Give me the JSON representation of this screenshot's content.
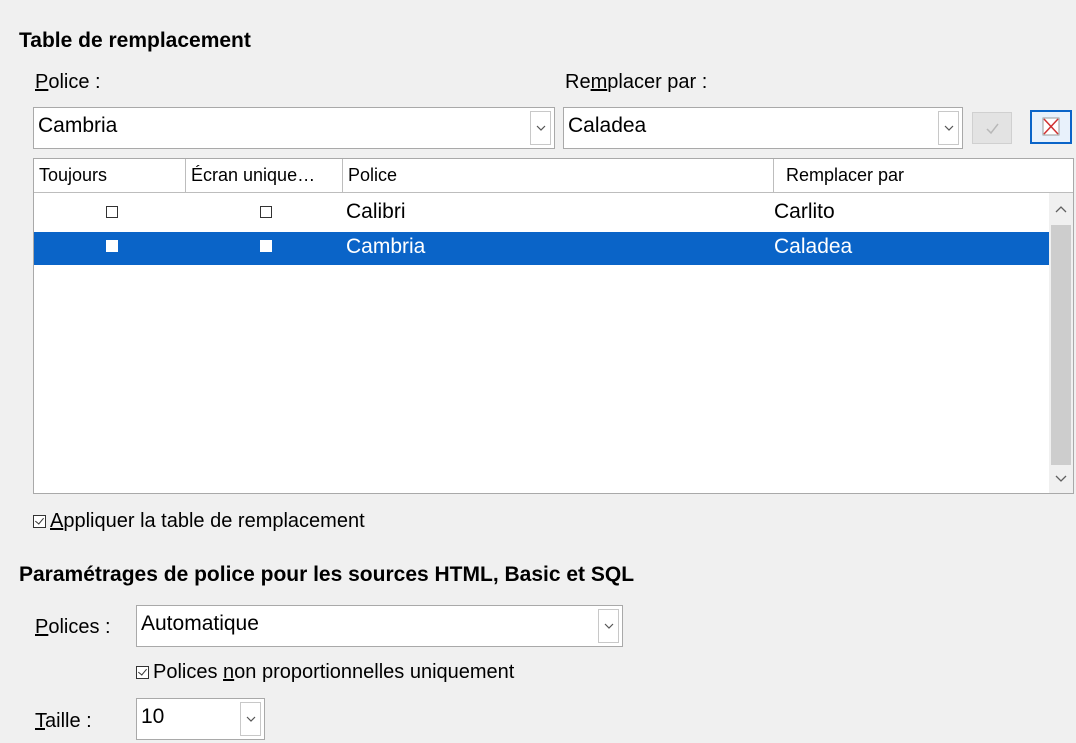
{
  "replacement": {
    "title": "Table de remplacement",
    "font_label_u": "P",
    "font_label_rest": "olice :",
    "replace_label_pre": "Re",
    "replace_label_u": "m",
    "replace_label_rest": "placer par :",
    "font_value": "Cambria",
    "replace_value": "Caladea",
    "apply_icon": "checkmark-icon",
    "delete_icon": "delete-x-icon",
    "columns": [
      "Toujours",
      "Écran unique…",
      "Police",
      "Remplacer par"
    ],
    "rows": [
      {
        "always": false,
        "screen_only": false,
        "font": "Calibri",
        "replace": "Carlito",
        "selected": false
      },
      {
        "always": false,
        "screen_only": false,
        "font": "Cambria",
        "replace": "Caladea",
        "selected": true
      }
    ],
    "apply_table_u": "A",
    "apply_table_rest": "ppliquer la table de remplacement",
    "apply_table_checked": true
  },
  "source_fonts": {
    "title": "Paramétrages de police pour les sources HTML, Basic et SQL",
    "fonts_label_u": "P",
    "fonts_label_rest": "olices :",
    "fonts_value": "Automatique",
    "nonprop_pre": "Polices ",
    "nonprop_u": "n",
    "nonprop_rest": "on proportionnelles uniquement",
    "nonprop_checked": true,
    "size_label_u": "T",
    "size_label_rest": "aille :",
    "size_value": "10"
  },
  "colors": {
    "selection": "#0a64c8",
    "background": "#f0f0f0"
  }
}
